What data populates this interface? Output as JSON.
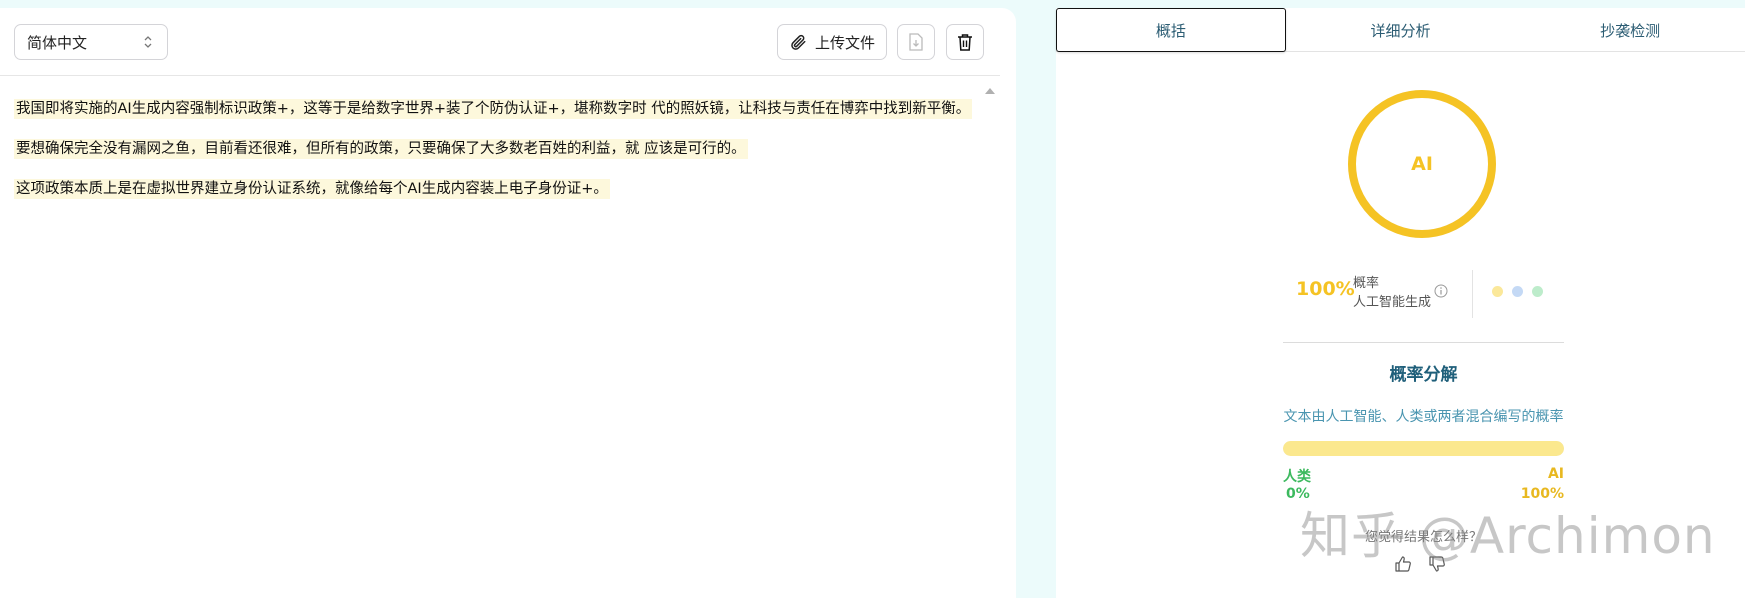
{
  "editor": {
    "language": "简体中文",
    "upload_label": "上传文件",
    "paragraphs": [
      "我国即将实施的AI生成内容强制标识政策+，这等于是给数字世界+装了个防伪认证+，堪称数字时 代的照妖镜，让科技与责任在博弈中找到新平衡。",
      "要想确保完全没有漏网之鱼，目前看还很难，但所有的政策，只要确保了大多数老百姓的利益，就 应该是可行的。",
      "这项政策本质上是在虚拟世界建立身份认证系统，就像给每个AI生成内容装上电子身份证+。"
    ]
  },
  "tabs": [
    {
      "label": "概括",
      "active": true
    },
    {
      "label": "详细分析",
      "active": false
    },
    {
      "label": "抄袭检测",
      "active": false
    }
  ],
  "summary": {
    "donut_label": "AI",
    "ai_probability": 100,
    "probability_value": "100%",
    "probability_label": "概率",
    "classification_label": "人工智能生成"
  },
  "breakdown": {
    "title": "概率分解",
    "subtitle": "文本由人工智能、人类或两者混合编写的概率",
    "ai_fraction": 1.0,
    "human_label": "人类",
    "human_pct": "0%",
    "ai_label": "AI",
    "ai_pct": "100%",
    "feedback_text": "您觉得结果怎么样？"
  },
  "watermark": "知乎 @Archimon",
  "colors": {
    "ai": "#f5c324",
    "human": "#3cb95e",
    "accent": "#1f5f7a",
    "highlight": "#fdf8dc"
  },
  "icons": {
    "chevron": "chevron-updown-icon",
    "upload": "paperclip-icon",
    "download": "file-download-icon",
    "delete": "trash-icon",
    "info": "info-icon",
    "like": "thumbs-up-icon",
    "dislike": "thumbs-down-icon"
  }
}
